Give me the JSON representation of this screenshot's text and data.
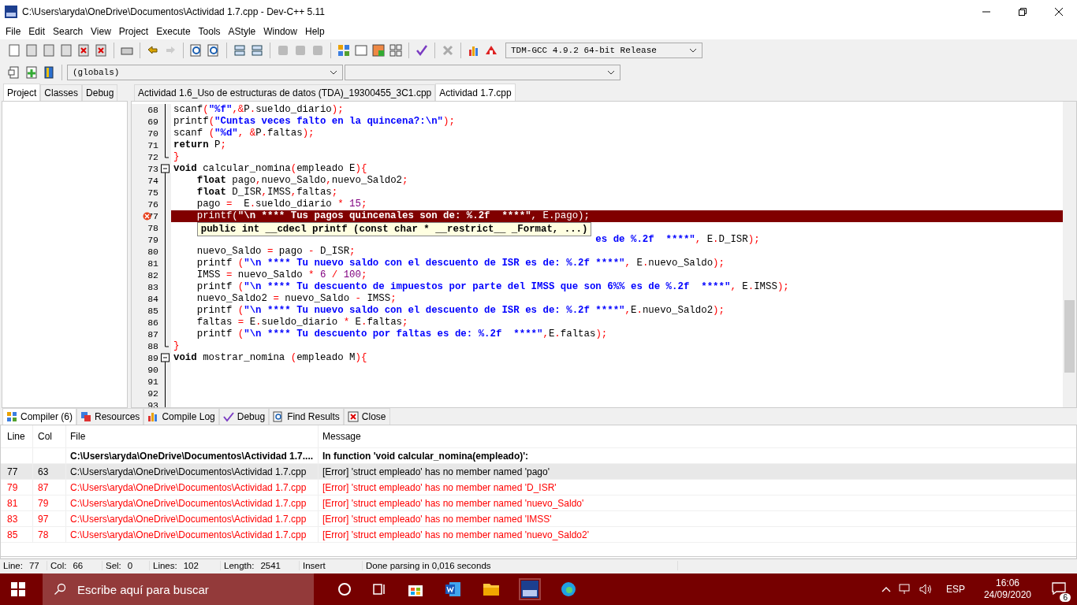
{
  "window": {
    "title": "C:\\Users\\aryda\\OneDrive\\Documentos\\Actividad 1.7.cpp - Dev-C++ 5.11"
  },
  "menu": [
    "File",
    "Edit",
    "Search",
    "View",
    "Project",
    "Execute",
    "Tools",
    "AStyle",
    "Window",
    "Help"
  ],
  "compiler_select": {
    "value": "TDM-GCC 4.9.2 64-bit Release"
  },
  "scope_select": {
    "value": "(globals)"
  },
  "side_tabs": [
    {
      "label": "Project",
      "selected": true
    },
    {
      "label": "Classes",
      "selected": false
    },
    {
      "label": "Debug",
      "selected": false
    }
  ],
  "file_tabs": [
    {
      "label": "Actividad 1.6_Uso de estructuras de datos (TDA)_19300455_3C1.cpp",
      "selected": false
    },
    {
      "label": "Actividad 1.7.cpp",
      "selected": true
    }
  ],
  "code_lines": [
    {
      "num": "68",
      "kind": "body",
      "error": false,
      "tokens": [
        {
          "kind": "plain",
          "t": "scanf"
        },
        {
          "kind": "sym",
          "t": "("
        },
        {
          "kind": "str",
          "t": "\"%f\""
        },
        {
          "kind": "sym",
          "t": ",&"
        },
        {
          "kind": "plain",
          "t": "P"
        },
        {
          "kind": "sym",
          "t": "."
        },
        {
          "kind": "plain",
          "t": "sueldo_diario"
        },
        {
          "kind": "sym",
          "t": ");"
        }
      ]
    },
    {
      "num": "69",
      "kind": "body",
      "error": false,
      "tokens": [
        {
          "kind": "plain",
          "t": "printf"
        },
        {
          "kind": "sym",
          "t": "("
        },
        {
          "kind": "str",
          "t": "\"Cuntas veces falto en la quincena?:\\n\""
        },
        {
          "kind": "sym",
          "t": ");"
        }
      ]
    },
    {
      "num": "70",
      "kind": "body",
      "error": false,
      "tokens": [
        {
          "kind": "plain",
          "t": "scanf "
        },
        {
          "kind": "sym",
          "t": "("
        },
        {
          "kind": "str",
          "t": "\"%d\""
        },
        {
          "kind": "sym",
          "t": ", &"
        },
        {
          "kind": "plain",
          "t": "P"
        },
        {
          "kind": "sym",
          "t": "."
        },
        {
          "kind": "plain",
          "t": "faltas"
        },
        {
          "kind": "sym",
          "t": ");"
        }
      ]
    },
    {
      "num": "71",
      "kind": "body",
      "error": false,
      "tokens": [
        {
          "kind": "kw",
          "t": "return"
        },
        {
          "kind": "plain",
          "t": " P"
        },
        {
          "kind": "sym",
          "t": ";"
        }
      ]
    },
    {
      "num": "72",
      "kind": "fold_end",
      "error": false,
      "tokens": [
        {
          "kind": "sym",
          "t": "}"
        }
      ]
    },
    {
      "num": "73",
      "kind": "fold_start",
      "error": false,
      "tokens": [
        {
          "kind": "kw",
          "t": "void"
        },
        {
          "kind": "plain",
          "t": " calcular_nomina"
        },
        {
          "kind": "sym",
          "t": "("
        },
        {
          "kind": "plain",
          "t": "empleado E"
        },
        {
          "kind": "sym",
          "t": "){"
        }
      ]
    },
    {
      "num": "74",
      "kind": "body",
      "indented": true,
      "error": false,
      "tokens": [
        {
          "kind": "kw",
          "t": "float"
        },
        {
          "kind": "plain",
          "t": " pago"
        },
        {
          "kind": "sym",
          "t": ","
        },
        {
          "kind": "plain",
          "t": "nuevo_Saldo"
        },
        {
          "kind": "sym",
          "t": ","
        },
        {
          "kind": "plain",
          "t": "nuevo_Saldo2"
        },
        {
          "kind": "sym",
          "t": ";"
        }
      ]
    },
    {
      "num": "75",
      "kind": "body",
      "indented": true,
      "error": false,
      "tokens": [
        {
          "kind": "kw",
          "t": "float"
        },
        {
          "kind": "plain",
          "t": " D_ISR"
        },
        {
          "kind": "sym",
          "t": ","
        },
        {
          "kind": "plain",
          "t": "IMSS"
        },
        {
          "kind": "sym",
          "t": ","
        },
        {
          "kind": "plain",
          "t": "faltas"
        },
        {
          "kind": "sym",
          "t": ";"
        }
      ]
    },
    {
      "num": "76",
      "kind": "body",
      "indented": true,
      "error": false,
      "tokens": [
        {
          "kind": "plain",
          "t": "pago "
        },
        {
          "kind": "sym",
          "t": "="
        },
        {
          "kind": "plain",
          "t": "  E"
        },
        {
          "kind": "sym",
          "t": "."
        },
        {
          "kind": "plain",
          "t": "sueldo_diario "
        },
        {
          "kind": "sym",
          "t": "*"
        },
        {
          "kind": "num",
          "t": " 15"
        },
        {
          "kind": "sym",
          "t": ";"
        }
      ]
    },
    {
      "num": "77",
      "kind": "body",
      "indented": true,
      "error": true,
      "tokens": [
        {
          "kind": "plain",
          "t": "printf"
        },
        {
          "kind": "sym",
          "t": "("
        },
        {
          "kind": "str",
          "t": "\"\\n **** Tus pagos quincenales son de: %.2f  ****\""
        },
        {
          "kind": "sym",
          "t": ", "
        },
        {
          "kind": "plain",
          "t": "E"
        },
        {
          "kind": "sym",
          "t": "."
        },
        {
          "kind": "plain",
          "t": "pago"
        },
        {
          "kind": "sym",
          "t": ");"
        }
      ]
    },
    {
      "num": "78",
      "kind": "body",
      "error": false
    },
    {
      "num": "79",
      "kind": "body",
      "covered": true,
      "error": false,
      "tokens": [
        {
          "kind": "str",
          "t": "es de %.2f  ****\""
        },
        {
          "kind": "sym",
          "t": ", "
        },
        {
          "kind": "plain",
          "t": "E"
        },
        {
          "kind": "sym",
          "t": "."
        },
        {
          "kind": "plain",
          "t": "D_ISR"
        },
        {
          "kind": "sym",
          "t": ");"
        }
      ]
    },
    {
      "num": "80",
      "kind": "body",
      "indented": true,
      "error": false,
      "tokens": [
        {
          "kind": "plain",
          "t": "nuevo_Saldo "
        },
        {
          "kind": "sym",
          "t": "="
        },
        {
          "kind": "plain",
          "t": " pago "
        },
        {
          "kind": "sym",
          "t": "-"
        },
        {
          "kind": "plain",
          "t": " D_ISR"
        },
        {
          "kind": "sym",
          "t": ";"
        }
      ]
    },
    {
      "num": "81",
      "kind": "body",
      "indented": true,
      "error": false,
      "tokens": [
        {
          "kind": "plain",
          "t": "printf "
        },
        {
          "kind": "sym",
          "t": "("
        },
        {
          "kind": "str",
          "t": "\"\\n **** Tu nuevo saldo con el descuento de ISR es de: %.2f ****\""
        },
        {
          "kind": "sym",
          "t": ", "
        },
        {
          "kind": "plain",
          "t": "E"
        },
        {
          "kind": "sym",
          "t": "."
        },
        {
          "kind": "plain",
          "t": "nuevo_Saldo"
        },
        {
          "kind": "sym",
          "t": ");"
        }
      ]
    },
    {
      "num": "82",
      "kind": "body",
      "indented": true,
      "error": false,
      "tokens": [
        {
          "kind": "plain",
          "t": "IMSS "
        },
        {
          "kind": "sym",
          "t": "="
        },
        {
          "kind": "plain",
          "t": " nuevo_Saldo "
        },
        {
          "kind": "sym",
          "t": "*"
        },
        {
          "kind": "num",
          "t": " 6 "
        },
        {
          "kind": "sym",
          "t": "/"
        },
        {
          "kind": "num",
          "t": " 100"
        },
        {
          "kind": "sym",
          "t": ";"
        }
      ]
    },
    {
      "num": "83",
      "kind": "body",
      "indented": true,
      "error": false,
      "tokens": [
        {
          "kind": "plain",
          "t": "printf "
        },
        {
          "kind": "sym",
          "t": "("
        },
        {
          "kind": "str",
          "t": "\"\\n **** Tu descuento de impuestos por parte del IMSS que son 6%% es de %.2f  ****\""
        },
        {
          "kind": "sym",
          "t": ", "
        },
        {
          "kind": "plain",
          "t": "E"
        },
        {
          "kind": "sym",
          "t": "."
        },
        {
          "kind": "plain",
          "t": "IMSS"
        },
        {
          "kind": "sym",
          "t": ");"
        }
      ]
    },
    {
      "num": "84",
      "kind": "body",
      "indented": true,
      "error": false,
      "tokens": [
        {
          "kind": "plain",
          "t": "nuevo_Saldo2 "
        },
        {
          "kind": "sym",
          "t": "="
        },
        {
          "kind": "plain",
          "t": " nuevo_Saldo "
        },
        {
          "kind": "sym",
          "t": "-"
        },
        {
          "kind": "plain",
          "t": " IMSS"
        },
        {
          "kind": "sym",
          "t": ";"
        }
      ]
    },
    {
      "num": "85",
      "kind": "body",
      "indented": true,
      "error": false,
      "tokens": [
        {
          "kind": "plain",
          "t": "printf "
        },
        {
          "kind": "sym",
          "t": "("
        },
        {
          "kind": "str",
          "t": "\"\\n **** Tu nuevo saldo con el descuento de ISR es de: %.2f ****\""
        },
        {
          "kind": "sym",
          "t": ","
        },
        {
          "kind": "plain",
          "t": "E"
        },
        {
          "kind": "sym",
          "t": "."
        },
        {
          "kind": "plain",
          "t": "nuevo_Saldo2"
        },
        {
          "kind": "sym",
          "t": ");"
        }
      ]
    },
    {
      "num": "86",
      "kind": "body",
      "indented": true,
      "error": false,
      "tokens": [
        {
          "kind": "plain",
          "t": "faltas "
        },
        {
          "kind": "sym",
          "t": "="
        },
        {
          "kind": "plain",
          "t": " E"
        },
        {
          "kind": "sym",
          "t": "."
        },
        {
          "kind": "plain",
          "t": "sueldo_diario "
        },
        {
          "kind": "sym",
          "t": "*"
        },
        {
          "kind": "plain",
          "t": " E"
        },
        {
          "kind": "sym",
          "t": "."
        },
        {
          "kind": "plain",
          "t": "faltas"
        },
        {
          "kind": "sym",
          "t": ";"
        }
      ]
    },
    {
      "num": "87",
      "kind": "body",
      "indented": true,
      "error": false,
      "tokens": [
        {
          "kind": "plain",
          "t": "printf "
        },
        {
          "kind": "sym",
          "t": "("
        },
        {
          "kind": "str",
          "t": "\"\\n **** Tu descuento por faltas es de: %.2f  ****\""
        },
        {
          "kind": "sym",
          "t": ","
        },
        {
          "kind": "plain",
          "t": "E"
        },
        {
          "kind": "sym",
          "t": "."
        },
        {
          "kind": "plain",
          "t": "faltas"
        },
        {
          "kind": "sym",
          "t": ");"
        }
      ]
    },
    {
      "num": "88",
      "kind": "fold_end",
      "error": false,
      "tokens": [
        {
          "kind": "sym",
          "t": "}"
        }
      ]
    },
    {
      "num": "89",
      "kind": "fold_start",
      "error": false,
      "tokens": [
        {
          "kind": "kw",
          "t": "void"
        },
        {
          "kind": "plain",
          "t": " mostrar_nomina "
        },
        {
          "kind": "sym",
          "t": "("
        },
        {
          "kind": "plain",
          "t": "empleado M"
        },
        {
          "kind": "sym",
          "t": "){"
        }
      ]
    },
    {
      "num": "90",
      "kind": "body",
      "error": false
    },
    {
      "num": "91",
      "kind": "body",
      "error": false
    },
    {
      "num": "92",
      "kind": "body",
      "error": false
    },
    {
      "num": "93",
      "kind": "body",
      "error": false
    }
  ],
  "tooltip": "public int __cdecl printf (const char * __restrict__ _Format, ...)",
  "bottom_tabs": [
    {
      "label": "Compiler (6)",
      "selected": true
    },
    {
      "label": "Resources",
      "selected": false
    },
    {
      "label": "Compile Log",
      "selected": false
    },
    {
      "label": "Debug",
      "selected": false
    },
    {
      "label": "Find Results",
      "selected": false
    },
    {
      "label": "Close",
      "selected": false
    }
  ],
  "compiler_table": {
    "columns": [
      "Line",
      "Col",
      "File",
      "Message"
    ],
    "rows": [
      {
        "kind": "context",
        "selected": false,
        "cells": [
          "",
          "",
          "C:\\Users\\aryda\\OneDrive\\Documentos\\Actividad 1.7....",
          "In function 'void calcular_nomina(empleado)':"
        ]
      },
      {
        "kind": "error",
        "selected": true,
        "cells": [
          "77",
          "63",
          "C:\\Users\\aryda\\OneDrive\\Documentos\\Actividad 1.7.cpp",
          "[Error] 'struct empleado' has no member named 'pago'"
        ]
      },
      {
        "kind": "error",
        "selected": false,
        "cells": [
          "79",
          "87",
          "C:\\Users\\aryda\\OneDrive\\Documentos\\Actividad 1.7.cpp",
          "[Error] 'struct empleado' has no member named 'D_ISR'"
        ]
      },
      {
        "kind": "error",
        "selected": false,
        "cells": [
          "81",
          "79",
          "C:\\Users\\aryda\\OneDrive\\Documentos\\Actividad 1.7.cpp",
          "[Error] 'struct empleado' has no member named 'nuevo_Saldo'"
        ]
      },
      {
        "kind": "error",
        "selected": false,
        "cells": [
          "83",
          "97",
          "C:\\Users\\aryda\\OneDrive\\Documentos\\Actividad 1.7.cpp",
          "[Error] 'struct empleado' has no member named 'IMSS'"
        ]
      },
      {
        "kind": "error",
        "selected": false,
        "cells": [
          "85",
          "78",
          "C:\\Users\\aryda\\OneDrive\\Documentos\\Actividad 1.7.cpp",
          "[Error] 'struct empleado' has no member named 'nuevo_Saldo2'"
        ]
      }
    ]
  },
  "status_bar": [
    {
      "label": "Line:",
      "value": "77"
    },
    {
      "label": "Col:",
      "value": "66"
    },
    {
      "label": "Sel:",
      "value": "0"
    },
    {
      "label": "Lines:",
      "value": "102"
    },
    {
      "label": "Length:",
      "value": "2541"
    },
    {
      "label": "Insert"
    },
    {
      "label": "Done parsing in 0,016 seconds"
    }
  ],
  "taskbar": {
    "search": {
      "placeholder": "Escribe aquí para buscar"
    },
    "language": "ESP",
    "time": "16:06",
    "date": "24/09/2020",
    "notifications": "6"
  }
}
